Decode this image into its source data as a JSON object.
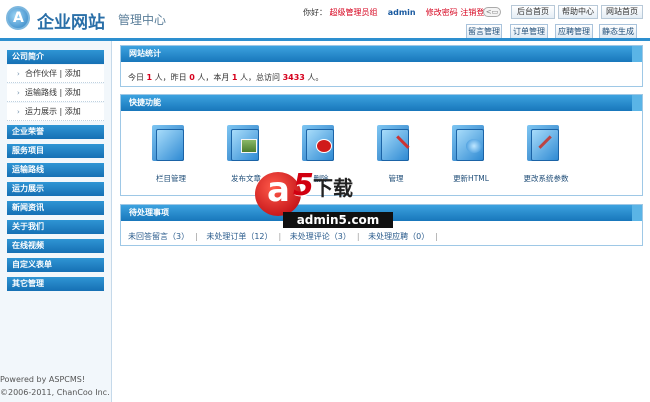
{
  "header": {
    "site_name": "企业网站",
    "sub_name": "管理中心",
    "greeting": "你好：",
    "role": "超级管理员组",
    "username": "admin",
    "change_password": "修改密码",
    "logout": "注销登录",
    "toggle": "<▢",
    "top_buttons": [
      "后台首页",
      "帮助中心",
      "网站首页"
    ],
    "nav_buttons": [
      "留言管理",
      "订单管理",
      "应聘管理",
      "静态生成"
    ]
  },
  "sidebar": {
    "groups": [
      {
        "label": "公司简介",
        "subs": [
          "合作伙伴 | 添加",
          "运输路线 | 添加",
          "运力展示 | 添加"
        ]
      },
      {
        "label": "企业荣誉"
      },
      {
        "label": "服务项目"
      },
      {
        "label": "运输路线"
      },
      {
        "label": "运力展示"
      },
      {
        "label": "新闻资讯"
      },
      {
        "label": "关于我们"
      },
      {
        "label": "在线视频"
      },
      {
        "label": "自定义表单"
      },
      {
        "label": "其它管理"
      }
    ],
    "footer": [
      "Powered by ASPCMS!",
      "©2006-2011, ChanCoo Inc."
    ]
  },
  "stats": {
    "title": "网站统计",
    "today_label": "今日",
    "today": "1",
    "yesterday_label": "人，昨日",
    "yesterday": "0",
    "month_label": "人，本月",
    "month": "1",
    "total_label": "人，总访问",
    "total": "3433",
    "suffix": "人。"
  },
  "quick": {
    "title": "快捷功能",
    "items": [
      {
        "label": "栏目管理",
        "icon": "folder-list-icon"
      },
      {
        "label": "发布文章",
        "icon": "folder-image-icon"
      },
      {
        "label": "删除",
        "icon": "folder-delete-icon"
      },
      {
        "label": "管理",
        "icon": "folder-tools-icon"
      },
      {
        "label": "更新HTML",
        "icon": "folder-globe-icon"
      },
      {
        "label": "更改系统参数",
        "icon": "folder-settings-icon"
      }
    ]
  },
  "pending": {
    "title": "待处理事项",
    "items": [
      "未回答留言（3）",
      "未处理订单（12）",
      "未处理评论（3）",
      "未处理应聘（0）"
    ]
  },
  "watermark": {
    "brand": "下载",
    "url": "admin5.com"
  }
}
